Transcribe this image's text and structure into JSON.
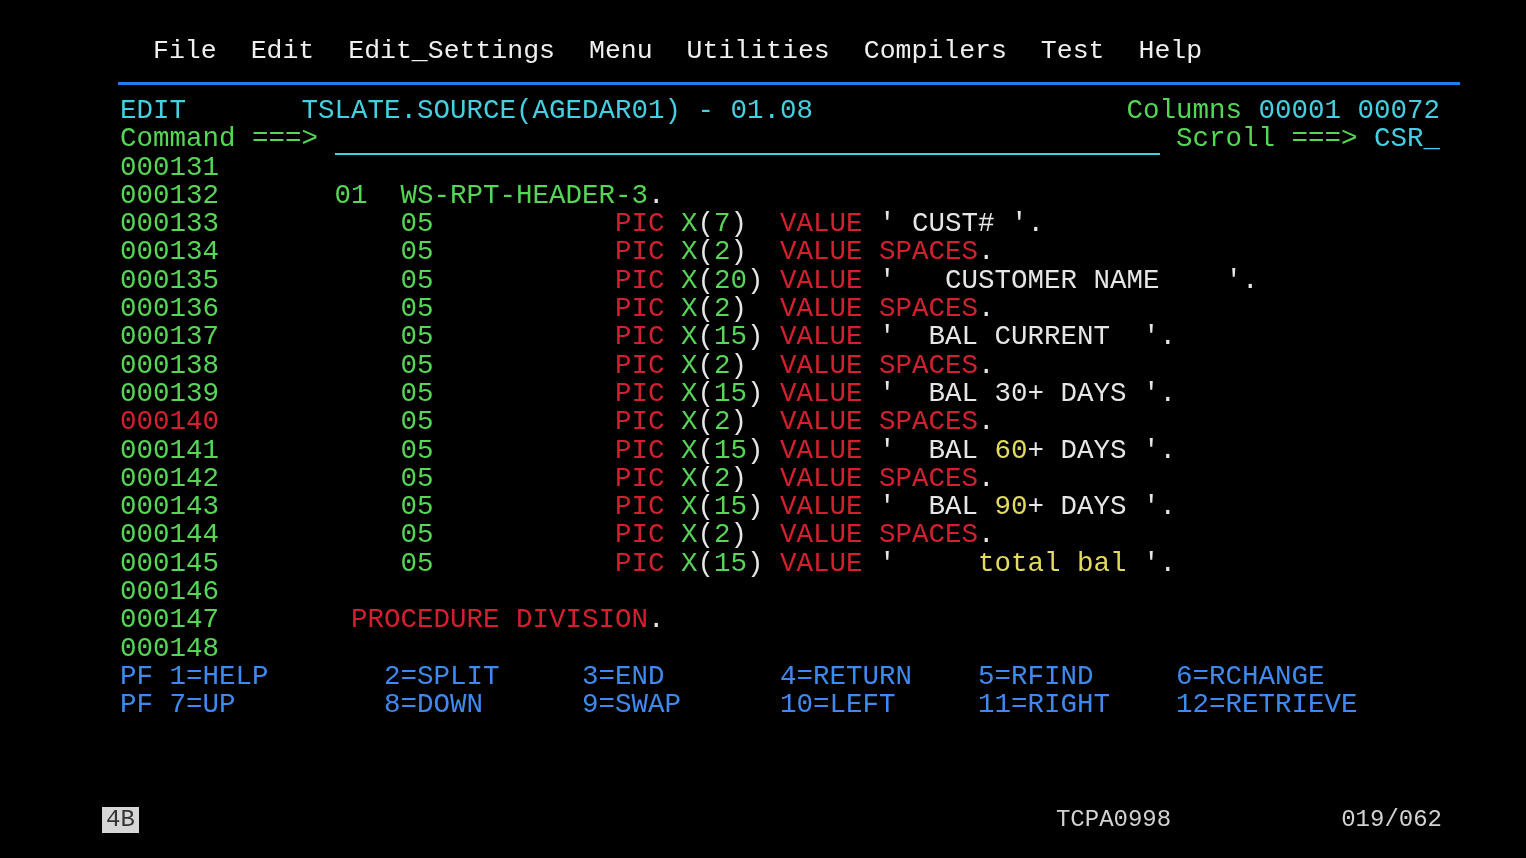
{
  "menu": [
    "File",
    "Edit",
    "Edit_Settings",
    "Menu",
    "Utilities",
    "Compilers",
    "Test",
    "Help"
  ],
  "header": {
    "mode": "EDIT",
    "dataset": "TSLATE.SOURCE(AGEDAR01) - 01.08",
    "columns_label": "Columns",
    "columns_from": "00001",
    "columns_to": "00072"
  },
  "command": {
    "label": "Command ===>",
    "scroll_label": "Scroll ===>",
    "scroll_value": "CSR_"
  },
  "lines": [
    {
      "number": "000131",
      "flagged": false
    },
    {
      "number": "000132",
      "flagged": false,
      "segments": [
        {
          "kind": "group-level",
          "text": "01"
        },
        {
          "kind": "data-name",
          "text": "WS-RPT-HEADER-3"
        },
        {
          "kind": "period",
          "text": "."
        }
      ]
    },
    {
      "number": "000133",
      "flagged": false,
      "segments": [
        {
          "kind": "item-level",
          "text": "05"
        },
        {
          "kind": "pic-keyword",
          "text": "PIC"
        },
        {
          "kind": "picture",
          "text": "X(7)"
        },
        {
          "kind": "value-keyword",
          "text": "VALUE"
        },
        {
          "kind": "literal",
          "parts": [
            {
              "text": "' CUST# '.",
              "changed": false
            }
          ]
        }
      ]
    },
    {
      "number": "000134",
      "flagged": false,
      "segments": [
        {
          "kind": "item-level",
          "text": "05"
        },
        {
          "kind": "pic-keyword",
          "text": "PIC"
        },
        {
          "kind": "picture",
          "text": "X(2)"
        },
        {
          "kind": "value-keyword",
          "text": "VALUE"
        },
        {
          "kind": "figurative",
          "text": "SPACES"
        },
        {
          "kind": "period",
          "text": "."
        }
      ]
    },
    {
      "number": "000135",
      "flagged": false,
      "segments": [
        {
          "kind": "item-level",
          "text": "05"
        },
        {
          "kind": "pic-keyword",
          "text": "PIC"
        },
        {
          "kind": "picture",
          "text": "X(20)"
        },
        {
          "kind": "value-keyword",
          "text": "VALUE"
        },
        {
          "kind": "literal",
          "parts": [
            {
              "text": "'   CUSTOMER NAME    '.",
              "changed": false
            }
          ]
        }
      ]
    },
    {
      "number": "000136",
      "flagged": false,
      "segments": [
        {
          "kind": "item-level",
          "text": "05"
        },
        {
          "kind": "pic-keyword",
          "text": "PIC"
        },
        {
          "kind": "picture",
          "text": "X(2)"
        },
        {
          "kind": "value-keyword",
          "text": "VALUE"
        },
        {
          "kind": "figurative",
          "text": "SPACES"
        },
        {
          "kind": "period",
          "text": "."
        }
      ]
    },
    {
      "number": "000137",
      "flagged": false,
      "segments": [
        {
          "kind": "item-level",
          "text": "05"
        },
        {
          "kind": "pic-keyword",
          "text": "PIC"
        },
        {
          "kind": "picture",
          "text": "X(15)"
        },
        {
          "kind": "value-keyword",
          "text": "VALUE"
        },
        {
          "kind": "literal",
          "parts": [
            {
              "text": "'  BAL CURRENT  '.",
              "changed": false
            }
          ]
        }
      ]
    },
    {
      "number": "000138",
      "flagged": false,
      "segments": [
        {
          "kind": "item-level",
          "text": "05"
        },
        {
          "kind": "pic-keyword",
          "text": "PIC"
        },
        {
          "kind": "picture",
          "text": "X(2)"
        },
        {
          "kind": "value-keyword",
          "text": "VALUE"
        },
        {
          "kind": "figurative",
          "text": "SPACES"
        },
        {
          "kind": "period",
          "text": "."
        }
      ]
    },
    {
      "number": "000139",
      "flagged": false,
      "segments": [
        {
          "kind": "item-level",
          "text": "05"
        },
        {
          "kind": "pic-keyword",
          "text": "PIC"
        },
        {
          "kind": "picture",
          "text": "X(15)"
        },
        {
          "kind": "value-keyword",
          "text": "VALUE"
        },
        {
          "kind": "literal",
          "parts": [
            {
              "text": "'  BAL 30+ DAYS '.",
              "changed": false
            }
          ]
        }
      ]
    },
    {
      "number": "000140",
      "flagged": true,
      "segments": [
        {
          "kind": "item-level",
          "text": "05"
        },
        {
          "kind": "pic-keyword",
          "text": "PIC"
        },
        {
          "kind": "picture",
          "text": "X(2)"
        },
        {
          "kind": "value-keyword",
          "text": "VALUE"
        },
        {
          "kind": "figurative",
          "text": "SPACES"
        },
        {
          "kind": "period",
          "text": "."
        }
      ]
    },
    {
      "number": "000141",
      "flagged": false,
      "segments": [
        {
          "kind": "item-level",
          "text": "05"
        },
        {
          "kind": "pic-keyword",
          "text": "PIC"
        },
        {
          "kind": "picture",
          "text": "X(15)"
        },
        {
          "kind": "value-keyword",
          "text": "VALUE"
        },
        {
          "kind": "literal",
          "parts": [
            {
              "text": "'  BAL ",
              "changed": false
            },
            {
              "text": "60",
              "changed": true
            },
            {
              "text": "+ DAYS '.",
              "changed": false
            }
          ]
        }
      ]
    },
    {
      "number": "000142",
      "flagged": false,
      "segments": [
        {
          "kind": "item-level",
          "text": "05"
        },
        {
          "kind": "pic-keyword",
          "text": "PIC"
        },
        {
          "kind": "picture",
          "text": "X(2)"
        },
        {
          "kind": "value-keyword",
          "text": "VALUE"
        },
        {
          "kind": "figurative",
          "text": "SPACES"
        },
        {
          "kind": "period",
          "text": "."
        }
      ]
    },
    {
      "number": "000143",
      "flagged": false,
      "segments": [
        {
          "kind": "item-level",
          "text": "05"
        },
        {
          "kind": "pic-keyword",
          "text": "PIC"
        },
        {
          "kind": "picture",
          "text": "X(15)"
        },
        {
          "kind": "value-keyword",
          "text": "VALUE"
        },
        {
          "kind": "literal",
          "parts": [
            {
              "text": "'  BAL ",
              "changed": false
            },
            {
              "text": "90",
              "changed": true
            },
            {
              "text": "+ DAYS '.",
              "changed": false
            }
          ]
        }
      ]
    },
    {
      "number": "000144",
      "flagged": false,
      "segments": [
        {
          "kind": "item-level",
          "text": "05"
        },
        {
          "kind": "pic-keyword",
          "text": "PIC"
        },
        {
          "kind": "picture",
          "text": "X(2)"
        },
        {
          "kind": "value-keyword",
          "text": "VALUE"
        },
        {
          "kind": "figurative",
          "text": "SPACES"
        },
        {
          "kind": "period",
          "text": "."
        }
      ]
    },
    {
      "number": "000145",
      "flagged": false,
      "segments": [
        {
          "kind": "item-level",
          "text": "05"
        },
        {
          "kind": "pic-keyword",
          "text": "PIC"
        },
        {
          "kind": "picture",
          "text": "X(15)"
        },
        {
          "kind": "value-keyword",
          "text": "VALUE"
        },
        {
          "kind": "literal",
          "parts": [
            {
              "text": "'     ",
              "changed": false
            },
            {
              "text": "total bal",
              "changed": true
            },
            {
              "text": " '.",
              "changed": false
            }
          ]
        }
      ]
    },
    {
      "number": "000146",
      "flagged": false
    },
    {
      "number": "000147",
      "flagged": false,
      "segments": [
        {
          "kind": "division",
          "text": "PROCEDURE DIVISION"
        },
        {
          "kind": "period",
          "text": "."
        }
      ]
    },
    {
      "number": "000148",
      "flagged": false
    }
  ],
  "pf_keys": [
    {
      "prefix": "PF",
      "keys": [
        "1=HELP",
        "2=SPLIT",
        "3=END",
        "4=RETURN",
        "5=RFIND",
        "6=RCHANGE"
      ]
    },
    {
      "prefix": "PF",
      "keys": [
        "7=UP",
        "8=DOWN",
        "9=SWAP",
        "10=LEFT",
        "11=RIGHT",
        "12=RETRIEVE"
      ]
    }
  ],
  "status_bar": {
    "indicator": "4B",
    "terminal": "TCPA0998",
    "position": "019/062"
  }
}
